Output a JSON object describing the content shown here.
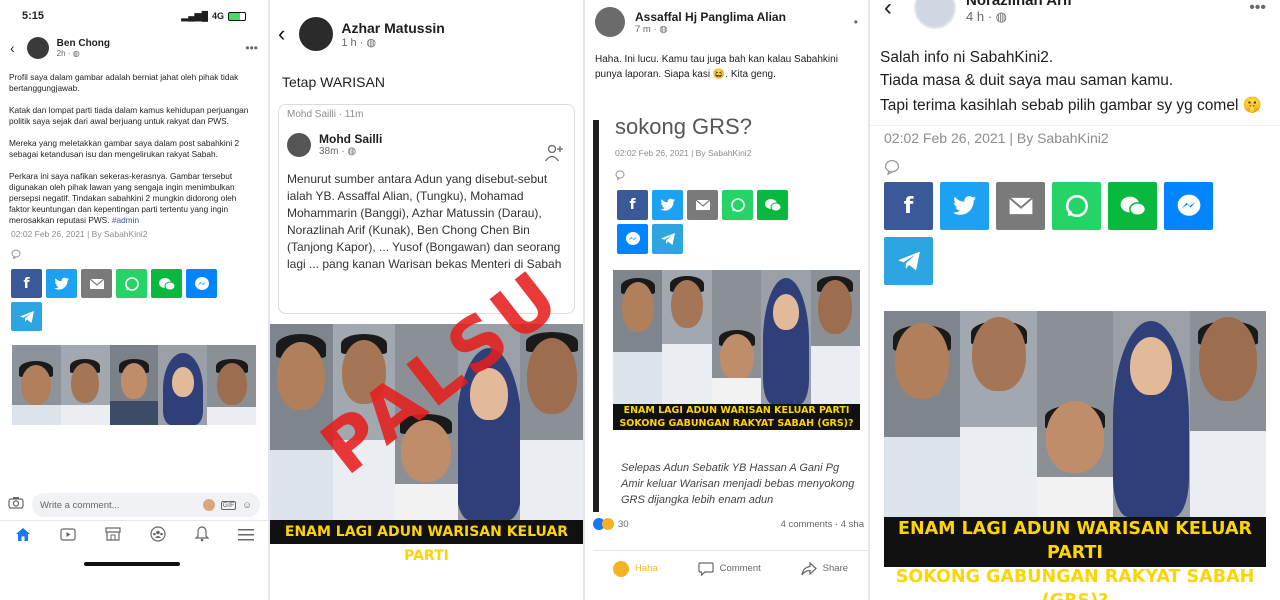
{
  "panel1": {
    "status": {
      "time": "5:15",
      "network": "4G"
    },
    "author": "Ben Chong",
    "time": "2h",
    "paragraphs": [
      "Profil saya dalam gambar adalah berniat jahat oleh pihak tidak bertanggungjawab.",
      "Katak dan lompat parti tiada dalam kamus kehidupan perjuangan politik saya sejak dari awal berjuang untuk rakyat dan PWS.",
      "Mereka yang meletakkan gambar saya dalam post sabahkini 2 sebagai ketandusan isu dan mengelirukan rakyat Sabah.",
      "Perkara ini saya nafikan sekeras-kerasnya. Gambar tersebut digunakan oleh pihak lawan yang sengaja ingin menimbulkan persepsi negatif. Tindakan sabahkini 2 mungkin didorong oleh faktor keuntungan dan kepentingan parti tertentu yang ingin merosakkan reputasi PWS."
    ],
    "hashtag": "#admin",
    "meta": "02:02 Feb 26, 2021  |  By SabahKini2",
    "comment_placeholder": "Write a comment...",
    "share_icons": [
      "facebook-icon",
      "twitter-icon",
      "email-icon",
      "whatsapp-icon",
      "wechat-icon",
      "messenger-icon",
      "telegram-icon"
    ],
    "tabs": [
      "home-icon",
      "watch-icon",
      "marketplace-icon",
      "groups-icon",
      "notifications-icon",
      "menu-icon"
    ]
  },
  "panel2": {
    "author": "Azhar Matussin",
    "time": "1 h",
    "message": "Tetap WARISAN",
    "shared_top": "Mohd Sailli · 11m",
    "inner_author": "Mohd Sailli",
    "inner_time": "38m",
    "inner_text": "Menurut sumber antara Adun yang disebut-sebut ialah YB. Assaffal Alian, (Tungku), Mohamad Mohammarin (Banggi), Azhar Matussin (Darau), Norazlinah Arif (Kunak), Ben Chong Chen Bin (Tanjong Kapor), ... Yusof (Bongawan) dan seorang lagi ... pang kanan Warisan bekas Menteri di Sabah",
    "stamp": "PALSU",
    "banner": "ENAM LAGI ADUN WARISAN KELUAR PARTI"
  },
  "panel3": {
    "author": "Assaffal Hj Panglima Alian",
    "time": "7 m",
    "message": "Haha. Ini lucu. Kamu tau juga bah kan kalau Sabahkini punya laporan. Siapa kasi 😆. Kita geng.",
    "article_title": "sokong GRS?",
    "meta": "02:02 Feb 26, 2021  |  By SabahKini2",
    "banner_line1": "ENAM LAGI ADUN WARISAN KELUAR PARTI",
    "banner_line2": "SOKONG GABUNGAN RAKYAT SABAH (GRS)?",
    "article_body": "Selepas Adun Sebatik YB Hassan A Gani Pg Amir keluar Warisan menjadi bebas menyokong GRS dijangka lebih enam adun",
    "reaction_count": "30",
    "comments": "4 comments · 4 sha",
    "action_haha": "Haha",
    "action_comment": "Comment",
    "action_share": "Share"
  },
  "panel4": {
    "author": "Norazlinah Arif",
    "time": "4 h",
    "lines": [
      "Salah info ni SabahKini2.",
      "Tiada masa & duit saya mau saman kamu.",
      "Tapi terima kasihlah sebab pilih gambar sy yg comel 🤫"
    ],
    "meta": "02:02 Feb 26, 2021  |  By SabahKini2",
    "banner_line1": "ENAM LAGI ADUN WARISAN KELUAR PARTI",
    "banner_line2": "SOKONG GABUNGAN RAKYAT SABAH (GRS)?"
  },
  "colors": {
    "facebook": "#3b5998",
    "twitter": "#1da1f2",
    "whatsapp": "#25d366",
    "messenger": "#0084ff",
    "telegram": "#2ca5e0",
    "stamp": "#e61e1e",
    "banner_text": "#ffd500"
  }
}
